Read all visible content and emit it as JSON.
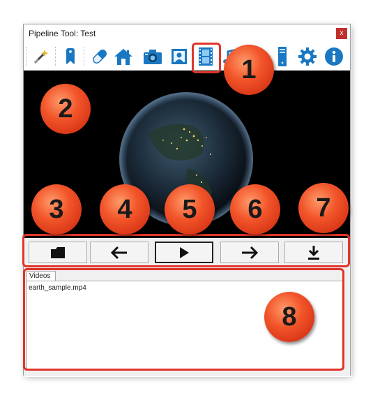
{
  "window": {
    "title": "Pipeline Tool: Test",
    "close_label": "x"
  },
  "toolbar": {
    "items": [
      {
        "icon": "magic-wand-icon"
      },
      {
        "icon": "bookmark-icon"
      },
      {
        "icon": "pill-icon"
      },
      {
        "icon": "home-icon"
      },
      {
        "icon": "camera-icon"
      },
      {
        "icon": "portrait-icon"
      },
      {
        "icon": "film-icon",
        "selected": true
      },
      {
        "icon": "music-icon"
      },
      {
        "icon": "server-icon"
      },
      {
        "icon": "gear-icon"
      },
      {
        "icon": "info-icon"
      }
    ]
  },
  "player": {
    "buttons": [
      {
        "icon": "folder-icon"
      },
      {
        "icon": "arrow-left-icon"
      },
      {
        "icon": "play-icon",
        "active": true
      },
      {
        "icon": "arrow-right-icon"
      },
      {
        "icon": "download-icon"
      }
    ]
  },
  "videos": {
    "tab_label": "Videos",
    "items": [
      "earth_sample.mp4"
    ]
  },
  "annotations": {
    "labels": [
      "1",
      "2",
      "3",
      "4",
      "5",
      "6",
      "7",
      "8"
    ],
    "color": "#e0352a"
  }
}
